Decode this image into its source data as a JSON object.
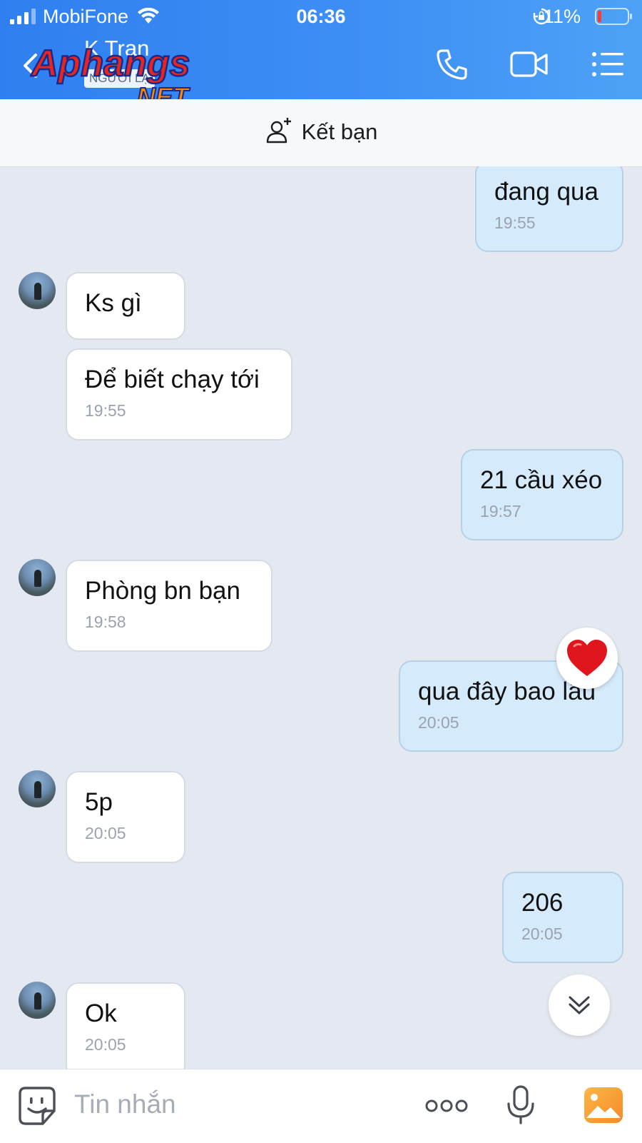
{
  "status_bar": {
    "carrier": "MobiFone",
    "time": "06:36",
    "battery": "11%"
  },
  "header": {
    "contact_name": "K Tran",
    "badge": "NGƯỜI LẠ",
    "watermark": "Aphangs",
    "watermark_suffix": ".NET",
    "icons": [
      "back-icon",
      "phone-icon",
      "video-icon",
      "menu-icon"
    ]
  },
  "subbar": {
    "add_friend_label": "Kết bạn"
  },
  "messages": [
    {
      "dir": "out",
      "text": "đang qua",
      "time": "19:55"
    },
    {
      "dir": "in",
      "text": "Ks gì",
      "time": ""
    },
    {
      "dir": "in",
      "text": "Để biết chạy tới",
      "time": "19:55"
    },
    {
      "dir": "out",
      "text": "21 cầu xéo",
      "time": "19:57"
    },
    {
      "dir": "in",
      "text": "Phòng bn bạn",
      "time": "19:58"
    },
    {
      "dir": "out",
      "text": "qua đây bao lâu",
      "time": "20:05",
      "reaction": "heart"
    },
    {
      "dir": "in",
      "text": "5p",
      "time": "20:05"
    },
    {
      "dir": "out",
      "text": "206",
      "time": "20:05"
    },
    {
      "dir": "in",
      "text": "Ok",
      "time": "20:05"
    }
  ],
  "composer": {
    "placeholder": "Tin nhắn",
    "value": ""
  },
  "colors": {
    "header_blue": "#3d8ef4",
    "outgoing_bubble": "#d5eafb",
    "incoming_bubble": "#ffffff",
    "chat_background": "#e4e8f0",
    "gallery_orange": "#f7a53c"
  }
}
